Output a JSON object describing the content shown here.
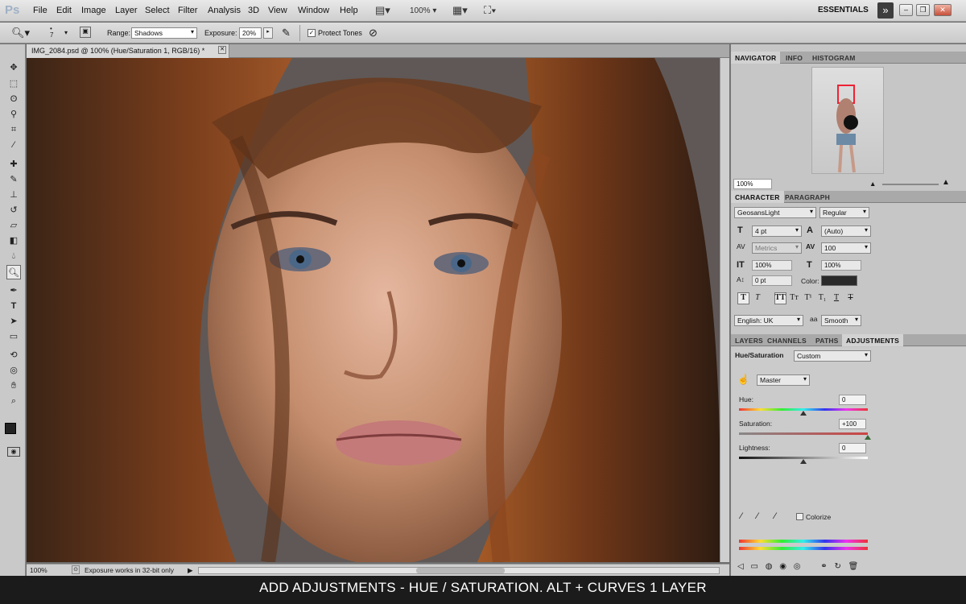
{
  "app": {
    "logo": "Ps"
  },
  "menu": [
    "File",
    "Edit",
    "Image",
    "Layer",
    "Select",
    "Filter",
    "Analysis",
    "3D",
    "View",
    "Window",
    "Help"
  ],
  "toolbar": {
    "zoom_value": "100%",
    "workspace": "ESSENTIALS"
  },
  "options": {
    "brush_size": "7",
    "range_label": "Range:",
    "range_value": "Shadows",
    "exposure_label": "Exposure:",
    "exposure_value": "20%",
    "protect_tones_label": "Protect Tones"
  },
  "document": {
    "tab_title": "IMG_2084.psd @ 100% (Hue/Saturation 1, RGB/16) *",
    "status_zoom": "100%",
    "status_message": "Exposure works in 32-bit only"
  },
  "navigator": {
    "tabs": [
      "NAVIGATOR",
      "INFO",
      "HISTOGRAM"
    ],
    "zoom": "100%"
  },
  "character": {
    "tabs": [
      "CHARACTER",
      "PARAGRAPH"
    ],
    "font_family": "GeosansLight",
    "font_style": "Regular",
    "font_size": "4 pt",
    "leading": "(Auto)",
    "kerning": "Metrics",
    "tracking": "100",
    "vertical_scale": "100%",
    "horizontal_scale": "100%",
    "baseline_shift": "0 pt",
    "color_label": "Color:",
    "language": "English: UK",
    "antialias_icon": "aa",
    "antialias": "Smooth"
  },
  "adjustments": {
    "tabs": [
      "LAYERS",
      "CHANNELS",
      "PATHS",
      "ADJUSTMENTS"
    ],
    "title": "Hue/Saturation",
    "preset": "Custom",
    "channel": "Master",
    "hue_label": "Hue:",
    "hue_value": "0",
    "saturation_label": "Saturation:",
    "saturation_value": "+100",
    "lightness_label": "Lightness:",
    "lightness_value": "0",
    "colorize_label": "Colorize",
    "hue_level": 0.5,
    "saturation_level": 1.0,
    "lightness_level": 0.5
  },
  "caption": "ADD ADJUSTMENTS - HUE / SATURATION. ALT + CURVES 1 LAYER",
  "colors": {
    "ui_panel": "#c6c6c6",
    "caption_bg": "#1b1b1b",
    "text_color_swatch": "#2a2a2a"
  },
  "icons": [
    "zoom-icon",
    "move-icon",
    "marquee-icon",
    "lasso-icon",
    "quick-select-icon",
    "crop-icon",
    "eyedropper-icon",
    "healing-icon",
    "brush-icon",
    "stamp-icon",
    "history-brush-icon",
    "eraser-icon",
    "gradient-icon",
    "blur-icon",
    "dodge-icon",
    "pen-icon",
    "type-icon",
    "path-select-icon",
    "shape-icon",
    "3d-rotate-icon",
    "3d-orbit-icon",
    "hand-icon",
    "zoom-tool-icon"
  ]
}
